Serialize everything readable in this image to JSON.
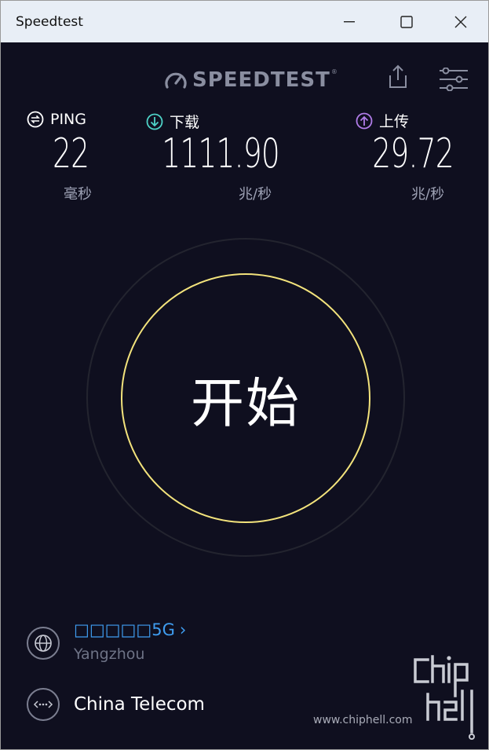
{
  "window": {
    "title": "Speedtest"
  },
  "header": {
    "logo_text": "SPEEDTEST",
    "logo_mark": "®"
  },
  "metrics": {
    "ping": {
      "label": "PING",
      "value": "22",
      "unit": "毫秒",
      "icon": "ping-icon"
    },
    "download": {
      "label": "下载",
      "value": "1111.90",
      "unit": "兆/秒",
      "icon": "download-arrow-icon"
    },
    "upload": {
      "label": "上传",
      "value": "29.72",
      "unit": "兆/秒",
      "icon": "upload-arrow-icon"
    }
  },
  "go_button": {
    "label": "开始"
  },
  "server": {
    "name": "□□□□□5G",
    "chevron": "›",
    "location": "Yangzhou"
  },
  "isp": {
    "name": "China Telecom"
  },
  "watermark": {
    "site": "www.chiphell.com",
    "logo_text": "chiphell"
  },
  "colors": {
    "background": "#0f0f1f",
    "download_accent": "#4ed2c7",
    "upload_accent": "#b07ce8",
    "go_ring": "#f3e37c",
    "server_link": "#3f9df0"
  }
}
